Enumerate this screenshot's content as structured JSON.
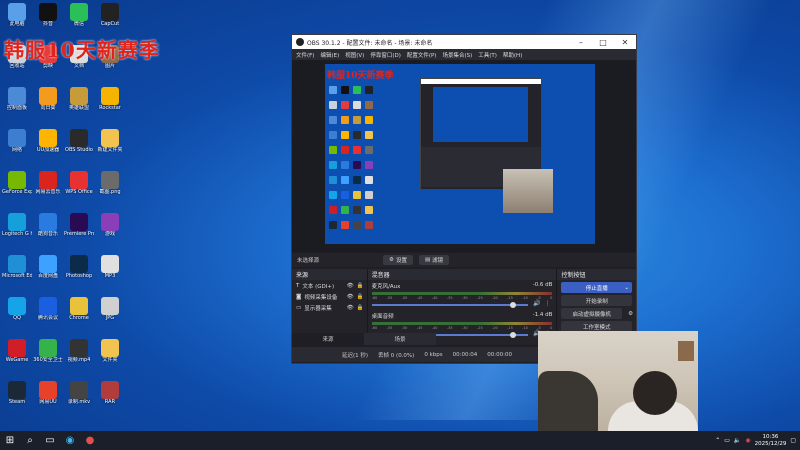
{
  "overlay_title": "韩服10天新赛季",
  "desktop_icons": [
    {
      "label": "此电脑",
      "color": "#5aa0e8",
      "col": 0,
      "row": 0
    },
    {
      "label": "回收站",
      "color": "#c9d3de",
      "col": 0,
      "row": 1
    },
    {
      "label": "控制面板",
      "color": "#4c8ad8",
      "col": 0,
      "row": 2
    },
    {
      "label": "网络",
      "color": "#3d7ed0",
      "col": 0,
      "row": 3
    },
    {
      "label": "GeForce Experience",
      "color": "#76b900",
      "col": 0,
      "row": 4
    },
    {
      "label": "Logitech G HUB",
      "color": "#15a0db",
      "col": 0,
      "row": 5
    },
    {
      "label": "Microsoft Edge",
      "color": "#1f8fd6",
      "col": 0,
      "row": 6
    },
    {
      "label": "QQ",
      "color": "#16a4e8",
      "col": 0,
      "row": 7
    },
    {
      "label": "WeGame",
      "color": "#d01d27",
      "col": 0,
      "row": 8
    },
    {
      "label": "Steam",
      "color": "#1b2838",
      "col": 0,
      "row": 9
    },
    {
      "label": "抖音",
      "color": "#111111",
      "col": 1,
      "row": 0
    },
    {
      "label": "剪映",
      "color": "#e23c3c",
      "col": 1,
      "row": 1
    },
    {
      "label": "向日葵",
      "color": "#f29b1d",
      "col": 1,
      "row": 2
    },
    {
      "label": "UU加速器",
      "color": "#ffb400",
      "col": 1,
      "row": 3
    },
    {
      "label": "网易云音乐",
      "color": "#d9251d",
      "col": 1,
      "row": 4
    },
    {
      "label": "酷狗音乐",
      "color": "#2a7be0",
      "col": 1,
      "row": 5
    },
    {
      "label": "百度网盘",
      "color": "#3fa1ff",
      "col": 1,
      "row": 6
    },
    {
      "label": "腾讯会议",
      "color": "#1a5fe0",
      "col": 1,
      "row": 7
    },
    {
      "label": "360安全卫士",
      "color": "#35b34a",
      "col": 1,
      "row": 8
    },
    {
      "label": "网易UU",
      "color": "#e7412a",
      "col": 1,
      "row": 9
    },
    {
      "label": "微信",
      "color": "#2ac057",
      "col": 2,
      "row": 0
    },
    {
      "label": "文档",
      "color": "#dddddd",
      "col": 2,
      "row": 1
    },
    {
      "label": "英雄联盟",
      "color": "#c69b3a",
      "col": 2,
      "row": 2
    },
    {
      "label": "OBS Studio",
      "color": "#2a2a2a",
      "col": 2,
      "row": 3
    },
    {
      "label": "WPS Office",
      "color": "#e83232",
      "col": 2,
      "row": 4
    },
    {
      "label": "Premiere Pro",
      "color": "#2a0a52",
      "col": 2,
      "row": 5
    },
    {
      "label": "Photoshop",
      "color": "#0c2b4a",
      "col": 2,
      "row": 6
    },
    {
      "label": "Chrome",
      "color": "#e8c23a",
      "col": 2,
      "row": 7
    },
    {
      "label": "视频.mp4",
      "color": "#333333",
      "col": 2,
      "row": 8
    },
    {
      "label": "录制.mkv",
      "color": "#444444",
      "col": 2,
      "row": 9
    },
    {
      "label": "CapCut",
      "color": "#222222",
      "col": 3,
      "row": 0
    },
    {
      "label": "图片",
      "color": "#8f6a4a",
      "col": 3,
      "row": 1
    },
    {
      "label": "Rockstar",
      "color": "#f5b400",
      "col": 3,
      "row": 2
    },
    {
      "label": "新建文件夹",
      "color": "#f2c44f",
      "col": 3,
      "row": 3
    },
    {
      "label": "截图.png",
      "color": "#6b6b6b",
      "col": 3,
      "row": 4
    },
    {
      "label": "游戏",
      "color": "#8a3fb8",
      "col": 3,
      "row": 5
    },
    {
      "label": "MP3",
      "color": "#e0e0e0",
      "col": 3,
      "row": 6
    },
    {
      "label": "JPG",
      "color": "#d0d0d0",
      "col": 3,
      "row": 7
    },
    {
      "label": "文件夹",
      "color": "#f2c44f",
      "col": 3,
      "row": 8
    },
    {
      "label": "RAR",
      "color": "#b03c3c",
      "col": 3,
      "row": 9
    }
  ],
  "obs": {
    "title": "OBS 30.1.2 - 配置文件: 未命名 - 场景: 未命名",
    "menu": [
      "文件(F)",
      "编辑(E)",
      "视图(V)",
      "停靠窗口(D)",
      "配置文件(P)",
      "场景集合(S)",
      "工具(T)",
      "帮助(H)"
    ],
    "no_source": "未选择源",
    "settings_btn": "设置",
    "filters_btn": "滤镜",
    "sources_title": "来源",
    "sources": [
      {
        "name": "文本 (GDI+)",
        "icon": "text-icon"
      },
      {
        "name": "视频采集设备",
        "icon": "camera-icon"
      },
      {
        "name": "显示器采集",
        "icon": "monitor-icon"
      }
    ],
    "mixer_title": "混音器",
    "mixer": [
      {
        "name": "麦克风/Aux",
        "db": "-0.6 dB",
        "level": 0.92
      },
      {
        "name": "桌面音频",
        "db": "-1.4 dB",
        "level": 0.92
      }
    ],
    "meter_scale": [
      "-60",
      "-55",
      "-50",
      "-45",
      "-40",
      "-35",
      "-30",
      "-25",
      "-20",
      "-15",
      "-10",
      "-5",
      "0"
    ],
    "controls_title": "控制按钮",
    "controls": {
      "stop_stream": "停止直播",
      "start_record": "开始录制",
      "virtual_cam": "启动虚拟摄像机",
      "studio_mode": "工作室模式",
      "settings": "设置"
    },
    "tabs": [
      "来源",
      "场景"
    ],
    "status": {
      "delay": "延迟(1 秒)",
      "dropped": "丢帧 0 (0.0%)",
      "kbps": "0 kbps",
      "time": "00:00:04",
      "rec_time": "00:00:00"
    }
  },
  "taskbar": {
    "time": "10:36",
    "date": "2025/12/29"
  }
}
